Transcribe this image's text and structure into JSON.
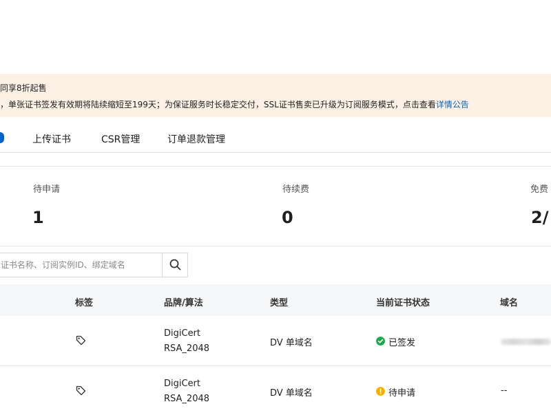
{
  "notice": {
    "line1": "同享8折起售",
    "line2_text": "，单张证书签发有效期将陆续缩短至199天；为保证服务时长稳定交付，SSL证书售卖已升级为订阅服务模式，点击查看",
    "line2_link": "详情公告"
  },
  "tabs": [
    {
      "label": "上传证书"
    },
    {
      "label": "CSR管理"
    },
    {
      "label": "订单退款管理"
    }
  ],
  "stats": [
    {
      "label": "待申请",
      "value": "1"
    },
    {
      "label": "待续费",
      "value": "0"
    },
    {
      "label": "免费",
      "value": "2/"
    }
  ],
  "search": {
    "placeholder": "证书名称、订阅实例ID、绑定域名",
    "icon": "search-icon"
  },
  "table": {
    "headers": [
      "标签",
      "品牌/算法",
      "类型",
      "当前证书状态",
      "域名"
    ],
    "rows": [
      {
        "tag_icon": "tag-icon",
        "brand": "DigiCert",
        "algorithm": "RSA_2048",
        "type": "DV  单域名",
        "status": "已签发",
        "status_color": "#1ea84a",
        "status_icon": "check-circle-icon",
        "domain": ""
      },
      {
        "tag_icon": "tag-icon",
        "brand": "DigiCert",
        "algorithm": "RSA_2048",
        "type": "DV  单域名",
        "status": "待申请",
        "status_color": "#f2b300",
        "status_icon": "warning-circle-icon",
        "domain": "--"
      }
    ]
  },
  "colors": {
    "accent": "#0064c8",
    "notice_bg": "#fdf1e6",
    "header_bg": "#f5f6f7"
  }
}
